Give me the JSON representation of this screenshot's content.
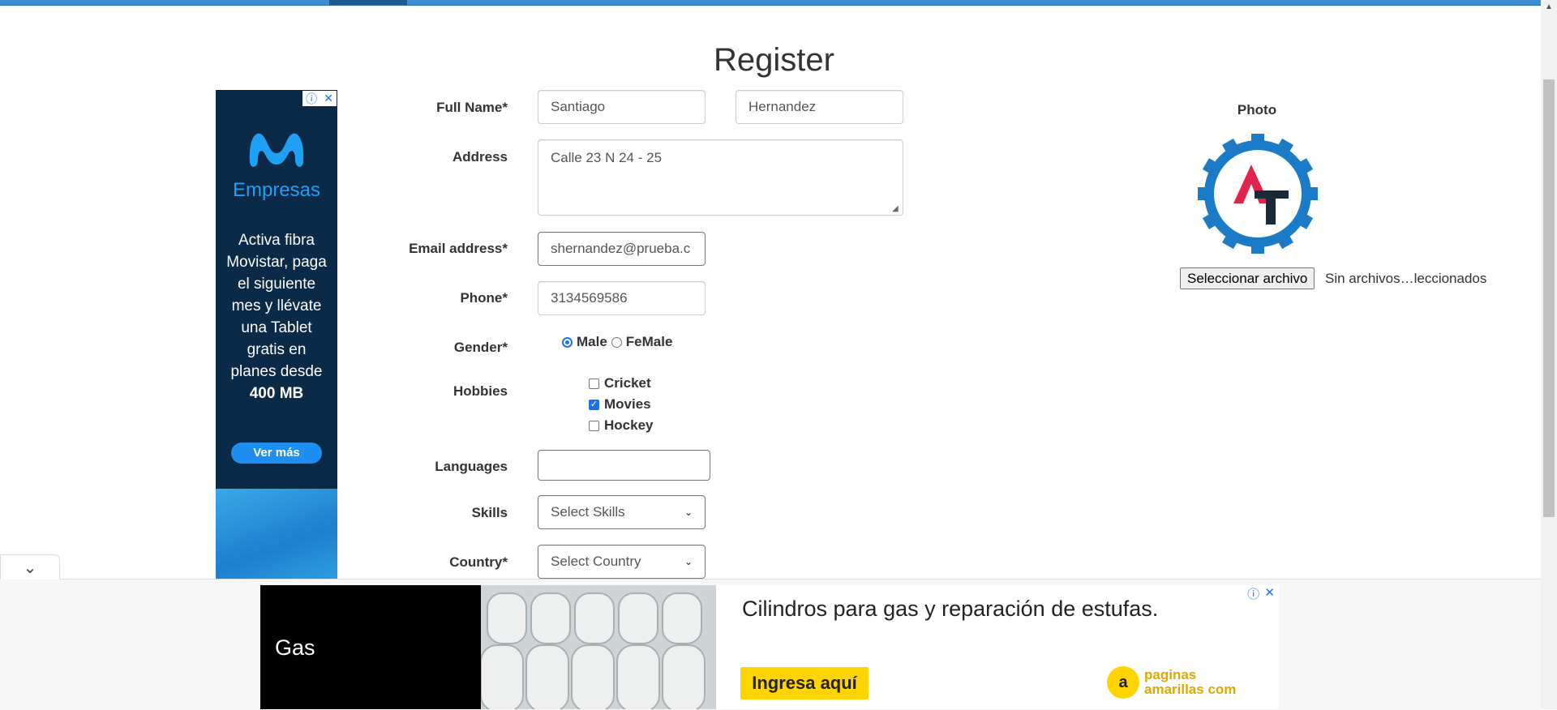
{
  "page": {
    "title": "Register"
  },
  "form": {
    "full_name": {
      "label": "Full Name*",
      "first_value": "Santiago",
      "last_value": "Hernandez"
    },
    "address": {
      "label": "Address",
      "value": "Calle 23 N 24 - 25"
    },
    "email": {
      "label": "Email address*",
      "value": "shernandez@prueba.c"
    },
    "phone": {
      "label": "Phone*",
      "value": "3134569586"
    },
    "gender": {
      "label": "Gender*",
      "options": [
        "Male",
        "FeMale"
      ],
      "selected": "Male"
    },
    "hobbies": {
      "label": "Hobbies",
      "options": [
        "Cricket",
        "Movies",
        "Hockey"
      ],
      "checked": [
        "Movies"
      ]
    },
    "languages": {
      "label": "Languages",
      "value": ""
    },
    "skills": {
      "label": "Skills",
      "selected": "Select Skills"
    },
    "country": {
      "label": "Country*",
      "selected": "Select Country"
    }
  },
  "photo": {
    "label": "Photo",
    "logo_text": "AT",
    "file_button": "Seleccionar archivo",
    "file_status": "Sin archivos…leccionados"
  },
  "left_ad": {
    "brand": "Empresas",
    "text": "Activa fibra Movistar, paga el siguiente mes y llévate una Tablet gratis en planes desde",
    "highlight": "400 MB",
    "cta": "Ver más"
  },
  "bottom_ad": {
    "label": "Gas",
    "headline": "Cilindros para gas y reparación de estufas.",
    "cta": "Ingresa aquí",
    "brand": "paginas amarillas com"
  },
  "colors": {
    "accent": "#1a73e8",
    "nav": "#3f8fd2",
    "ad_dark": "#0b2a47",
    "ad_yellow": "#ffd400"
  }
}
